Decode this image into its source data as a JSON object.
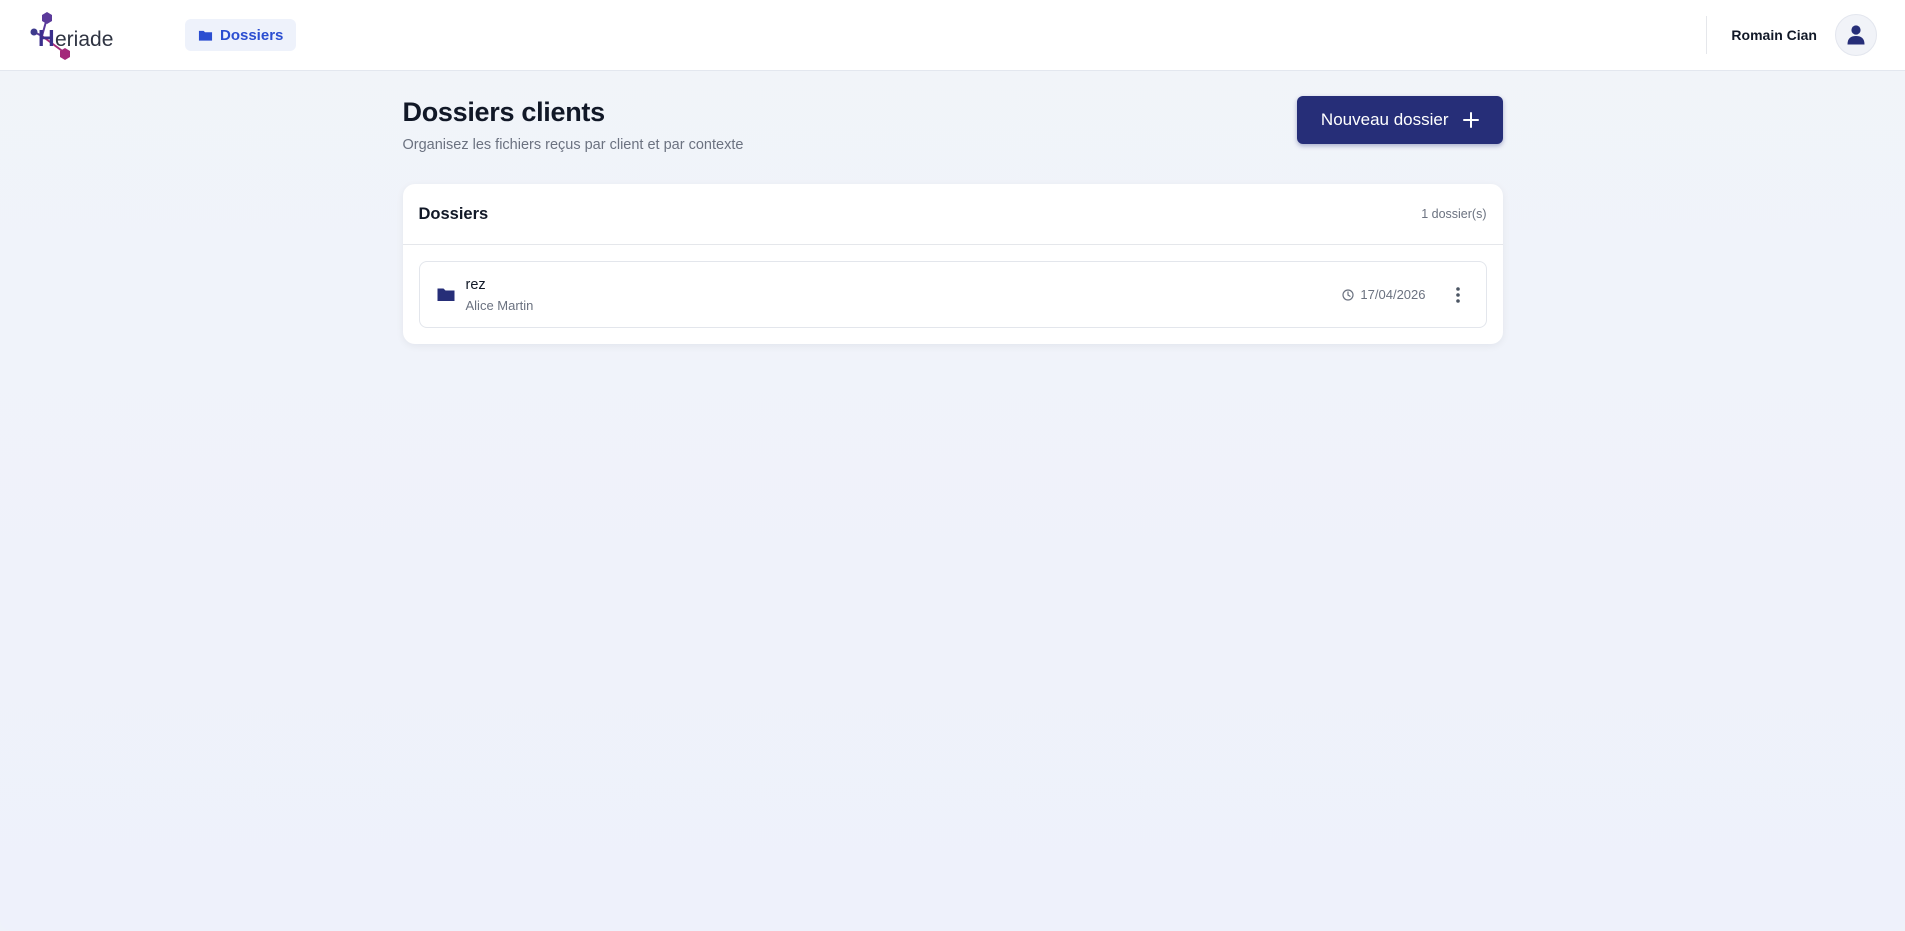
{
  "brand": {
    "logo_text": "eriade",
    "logo_initial": "H"
  },
  "nav": {
    "active_label": "Dossiers"
  },
  "user": {
    "name": "Romain Cian"
  },
  "page": {
    "title": "Dossiers clients",
    "subtitle": "Organisez les fichiers reçus par client et par contexte",
    "new_button_label": "Nouveau dossier"
  },
  "folders_card": {
    "title": "Dossiers",
    "count_label": "1 dossier(s)",
    "items": [
      {
        "name": "rez",
        "client": "Alice Martin",
        "date": "17/04/2026"
      }
    ]
  },
  "colors": {
    "accent": "#262e78",
    "nav_active": "#2b4ed1",
    "logo_purple": "#5b3a9a",
    "logo_magenta": "#a4287a"
  }
}
